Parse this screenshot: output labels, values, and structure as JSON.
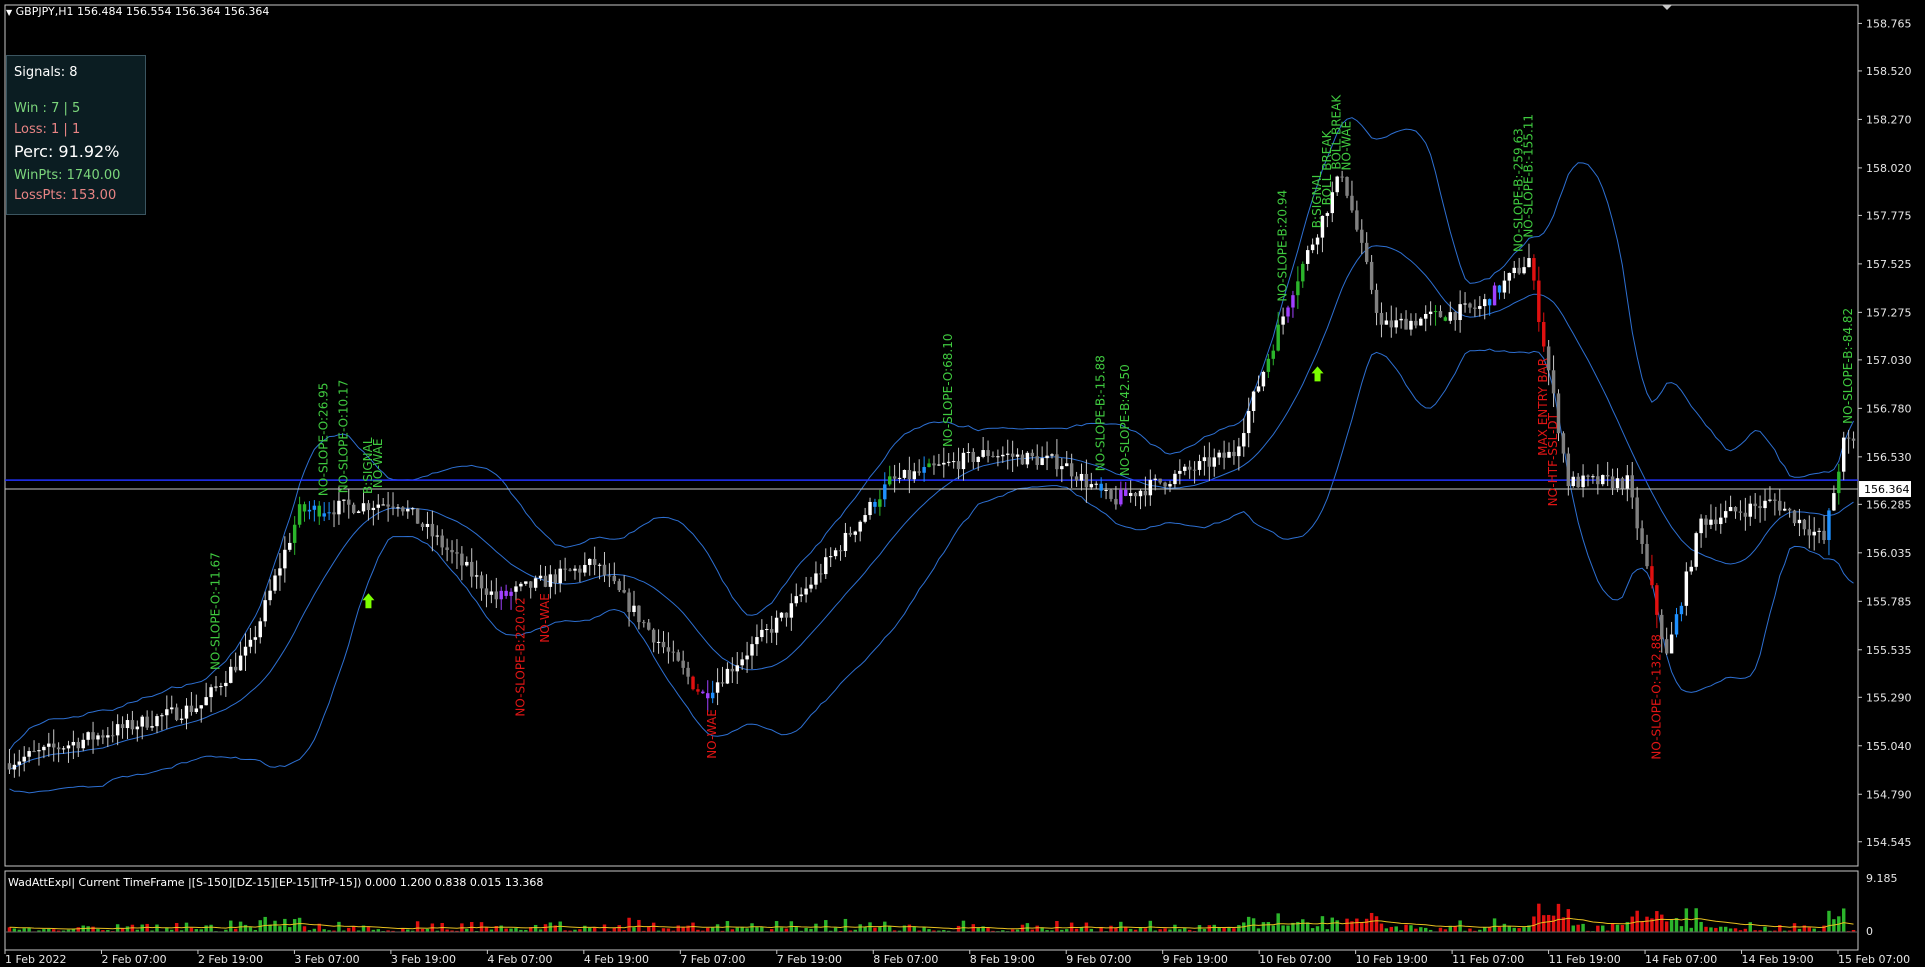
{
  "symbol": {
    "arrow": "▼",
    "label": "GBPJPY,H1",
    "ohlc": "156.484 156.554 156.364 156.364"
  },
  "panel": {
    "signals": "Signals: 8",
    "win": "Win : 7 | 5",
    "loss": "Loss: 1 | 1",
    "perc": "Perc: 91.92%",
    "winpts": "WinPts: 1740.00",
    "losspts": "LossPts: 153.00"
  },
  "indicator": {
    "label": "WadAttExpl| Current TimeFrame |[S-150][DZ-15][EP-15][TrP-15]) 0.000 1.200 0.838 0.015 13.368",
    "axis_top": "9.185",
    "axis_zero": "0"
  },
  "current_price": "156.364",
  "colors": {
    "background": "#000000",
    "bull": "#ffffff",
    "bear": "#808080",
    "green": "#2bb52b",
    "red": "#e01010",
    "blue": "#1e90ff",
    "purple": "#a040ff",
    "band": "#2d6fd1",
    "label_green": "#3fc93f",
    "label_red": "#e01515",
    "arrow": "#7cff00",
    "hline": "#2233ff"
  },
  "chart_data": {
    "type": "candlestick",
    "ylim": [
      154.42,
      158.86
    ],
    "yticks": [
      "158.765",
      "158.520",
      "158.270",
      "158.020",
      "157.775",
      "157.525",
      "157.275",
      "157.030",
      "156.780",
      "156.530",
      "156.285",
      "156.035",
      "155.785",
      "155.535",
      "155.290",
      "155.040",
      "154.790",
      "154.545"
    ],
    "xticks": [
      "1 Feb 2022",
      "2 Feb 07:00",
      "2 Feb 19:00",
      "3 Feb 07:00",
      "3 Feb 19:00",
      "4 Feb 07:00",
      "4 Feb 19:00",
      "7 Feb 07:00",
      "7 Feb 19:00",
      "8 Feb 07:00",
      "8 Feb 19:00",
      "9 Feb 07:00",
      "9 Feb 19:00",
      "10 Feb 07:00",
      "10 Feb 19:00",
      "11 Feb 07:00",
      "11 Feb 19:00",
      "14 Feb 07:00",
      "14 Feb 19:00",
      "15 Feb 07:00"
    ],
    "key_prices": [
      {
        "x": 0,
        "price": 154.95
      },
      {
        "x": 40,
        "price": 155.25
      },
      {
        "x": 50,
        "price": 155.55
      },
      {
        "x": 60,
        "price": 156.25
      },
      {
        "x": 80,
        "price": 156.3
      },
      {
        "x": 100,
        "price": 155.8
      },
      {
        "x": 120,
        "price": 155.98
      },
      {
        "x": 142,
        "price": 155.3
      },
      {
        "x": 160,
        "price": 155.75
      },
      {
        "x": 180,
        "price": 156.4
      },
      {
        "x": 200,
        "price": 156.55
      },
      {
        "x": 215,
        "price": 156.5
      },
      {
        "x": 225,
        "price": 156.3
      },
      {
        "x": 250,
        "price": 156.55
      },
      {
        "x": 262,
        "price": 157.4
      },
      {
        "x": 272,
        "price": 158.0
      },
      {
        "x": 280,
        "price": 157.2
      },
      {
        "x": 300,
        "price": 157.3
      },
      {
        "x": 310,
        "price": 157.55
      },
      {
        "x": 318,
        "price": 156.4
      },
      {
        "x": 330,
        "price": 156.4
      },
      {
        "x": 338,
        "price": 155.5
      },
      {
        "x": 345,
        "price": 156.2
      },
      {
        "x": 360,
        "price": 156.3
      },
      {
        "x": 370,
        "price": 156.1
      },
      {
        "x": 374,
        "price": 156.6
      }
    ],
    "hline_price": 156.41,
    "signal_labels": [
      {
        "text": "NO-SLOPE-O:-11.67",
        "color": "green",
        "bar": 42
      },
      {
        "text": "NO-SLOPE-O:26.95",
        "color": "green",
        "bar": 64
      },
      {
        "text": "NO-SLOPE-O:10.17",
        "color": "green",
        "bar": 68
      },
      {
        "text": "B:SIGNAL",
        "color": "green",
        "bar": 73
      },
      {
        "text": "NO-WAE",
        "color": "green",
        "bar": 75
      },
      {
        "text": "NO-SLOPE-B:220.02",
        "color": "red",
        "bar": 104
      },
      {
        "text": "NO-WAE",
        "color": "red",
        "bar": 109
      },
      {
        "text": "NO-WAE",
        "color": "red",
        "bar": 143
      },
      {
        "text": "NO-SLOPE-O:68.10",
        "color": "green",
        "bar": 191
      },
      {
        "text": "NO-SLOPE-B:-15.88",
        "color": "green",
        "bar": 222
      },
      {
        "text": "NO-SLOPE-B:42.50",
        "color": "green",
        "bar": 227
      },
      {
        "text": "NO-SLOPE-B:20.94",
        "color": "green",
        "bar": 259
      },
      {
        "text": "B:SIGNAL",
        "color": "green",
        "bar": 266
      },
      {
        "text": "BOLL BREAK",
        "color": "green",
        "bar": 268
      },
      {
        "text": "BOLL BREAK",
        "color": "green",
        "bar": 270
      },
      {
        "text": "NO-WAE",
        "color": "green",
        "bar": 272
      },
      {
        "text": "NO-SLOPE-B:-259.63",
        "color": "green",
        "bar": 307
      },
      {
        "text": "NO-SLOPE-B:-155.11",
        "color": "green",
        "bar": 309
      },
      {
        "text": "MAX ENTRY BAR",
        "color": "red",
        "bar": 312
      },
      {
        "text": "NO-HTF-SSL-DT",
        "color": "red",
        "bar": 314
      },
      {
        "text": "NO-SLOPE-O:-132.88",
        "color": "red",
        "bar": 335
      },
      {
        "text": "NO-SLOPE-B:-84.82",
        "color": "green",
        "bar": 374
      }
    ]
  }
}
